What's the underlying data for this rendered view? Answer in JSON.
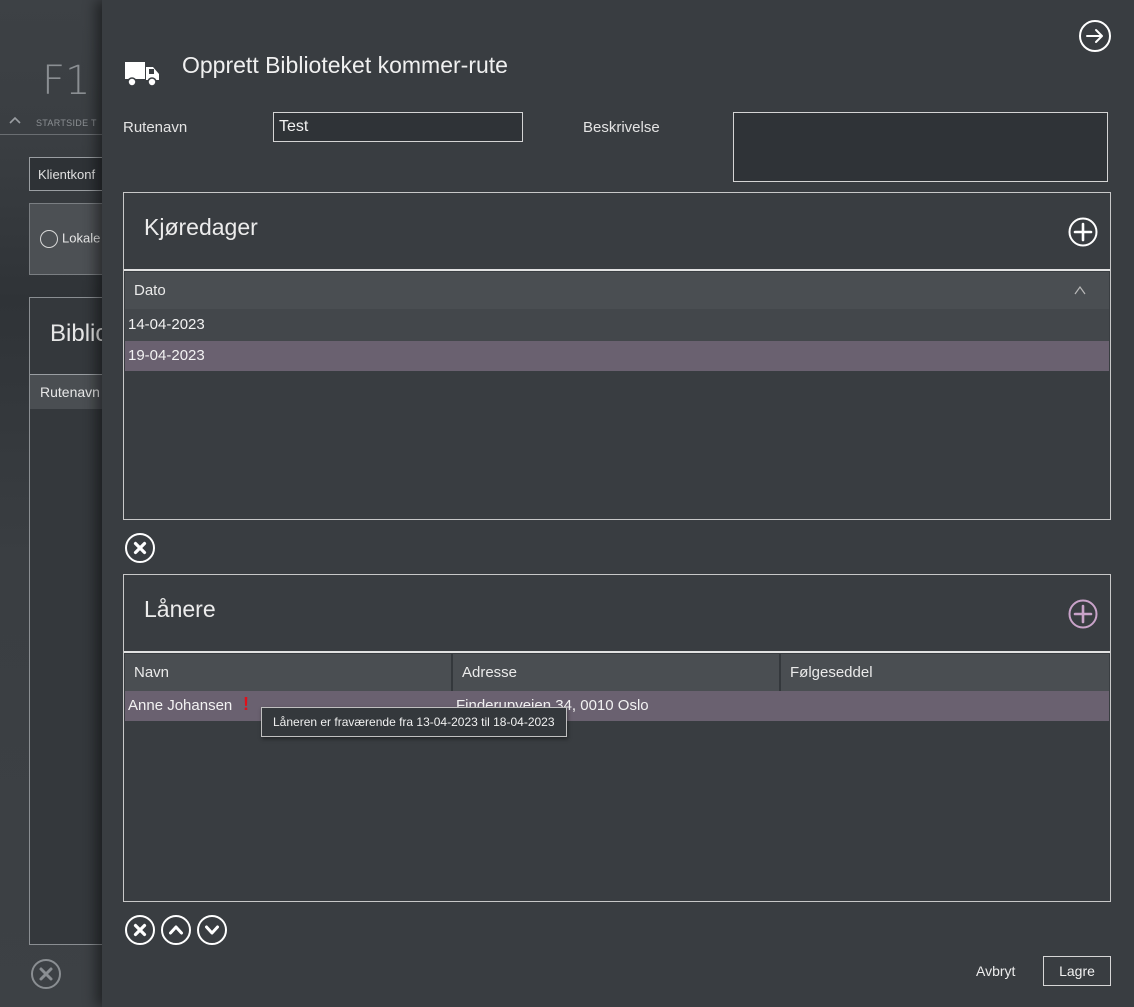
{
  "background_app": {
    "logo_text": "F1",
    "nav_label": "STARTSIDE T",
    "klient_button": "Klientkonf",
    "lokale_option": "Lokale",
    "panel_title": "Biblio",
    "panel_column": "Rutenavn"
  },
  "modal": {
    "title": "Opprett Biblioteket kommer-rute",
    "form": {
      "rutenavn_label": "Rutenavn",
      "rutenavn_value": "Test",
      "beskrivelse_label": "Beskrivelse",
      "beskrivelse_value": ""
    },
    "kjoredager": {
      "title": "Kjøredager",
      "columns": [
        "Dato"
      ],
      "rows": [
        {
          "dato": "14-04-2023",
          "selected": false
        },
        {
          "dato": "19-04-2023",
          "selected": true
        }
      ]
    },
    "lanere": {
      "title": "Lånere",
      "columns": [
        "Navn",
        "Adresse",
        "Følgeseddel"
      ],
      "rows": [
        {
          "navn": "Anne Johansen",
          "warning": "!",
          "adresse": "Finderupveien 34, 0010 Oslo",
          "folgeseddel": "",
          "selected": true
        }
      ],
      "tooltip": "Låneren er fraværende fra 13-04-2023 til 18-04-2023"
    },
    "footer": {
      "cancel_label": "Avbryt",
      "save_label": "Lagre"
    }
  },
  "colors": {
    "selected_row": "#6a6170",
    "alt_row": "#43474b",
    "warning": "#e0101a",
    "accent_add": "#c9a3c9"
  }
}
